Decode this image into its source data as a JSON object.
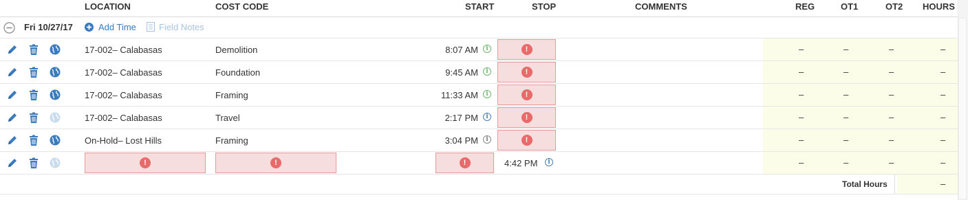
{
  "colors": {
    "accent_blue": "#3a7bbf",
    "error_red": "#e86a6a",
    "error_bg": "#f7dede",
    "hours_bg": "#fbfde8"
  },
  "header": {
    "location": "LOCATION",
    "cost_code": "COST CODE",
    "start": "START",
    "stop": "STOP",
    "comments": "COMMENTS",
    "reg": "REG",
    "ot1": "OT1",
    "ot2": "OT2",
    "hours": "HOURS"
  },
  "day": {
    "date": "Fri 10/27/17",
    "add_time": "Add Time",
    "field_notes": "Field Notes"
  },
  "rows": [
    {
      "location": "17-002– Calabasas",
      "cost_code": "Demolition",
      "start": "8:07 AM",
      "info_color": "green",
      "globe": "dark",
      "stop_error": true,
      "reg": "–",
      "ot1": "–",
      "ot2": "–",
      "hours": "–"
    },
    {
      "location": "17-002– Calabasas",
      "cost_code": "Foundation",
      "start": "9:45 AM",
      "info_color": "green",
      "globe": "dark",
      "stop_error": true,
      "reg": "–",
      "ot1": "–",
      "ot2": "–",
      "hours": "–"
    },
    {
      "location": "17-002– Calabasas",
      "cost_code": "Framing",
      "start": "11:33 AM",
      "info_color": "green",
      "globe": "dark",
      "stop_error": true,
      "reg": "–",
      "ot1": "–",
      "ot2": "–",
      "hours": "–"
    },
    {
      "location": "17-002– Calabasas",
      "cost_code": "Travel",
      "start": "2:17 PM",
      "info_color": "blue",
      "globe": "light",
      "stop_error": true,
      "reg": "–",
      "ot1": "–",
      "ot2": "–",
      "hours": "–"
    },
    {
      "location": "On-Hold– Lost Hills",
      "cost_code": "Framing",
      "start": "3:04 PM",
      "info_color": "gray",
      "globe": "dark",
      "stop_error": true,
      "reg": "–",
      "ot1": "–",
      "ot2": "–",
      "hours": "–"
    },
    {
      "location": "",
      "cost_code": "",
      "start": "",
      "stop": "4:42 PM",
      "info_color": "blue",
      "globe": "light",
      "reg": "–",
      "ot1": "–",
      "ot2": "–",
      "hours": "–"
    }
  ],
  "totals": {
    "label": "Total Hours",
    "value": "–"
  },
  "icons": {
    "edit": "pencil-icon",
    "delete": "trash-icon",
    "location": "globe-icon",
    "error": "exclamation-icon",
    "info": "info-icon",
    "collapse": "minus-circle-icon",
    "add": "plus-circle-icon",
    "notes": "notes-icon"
  }
}
